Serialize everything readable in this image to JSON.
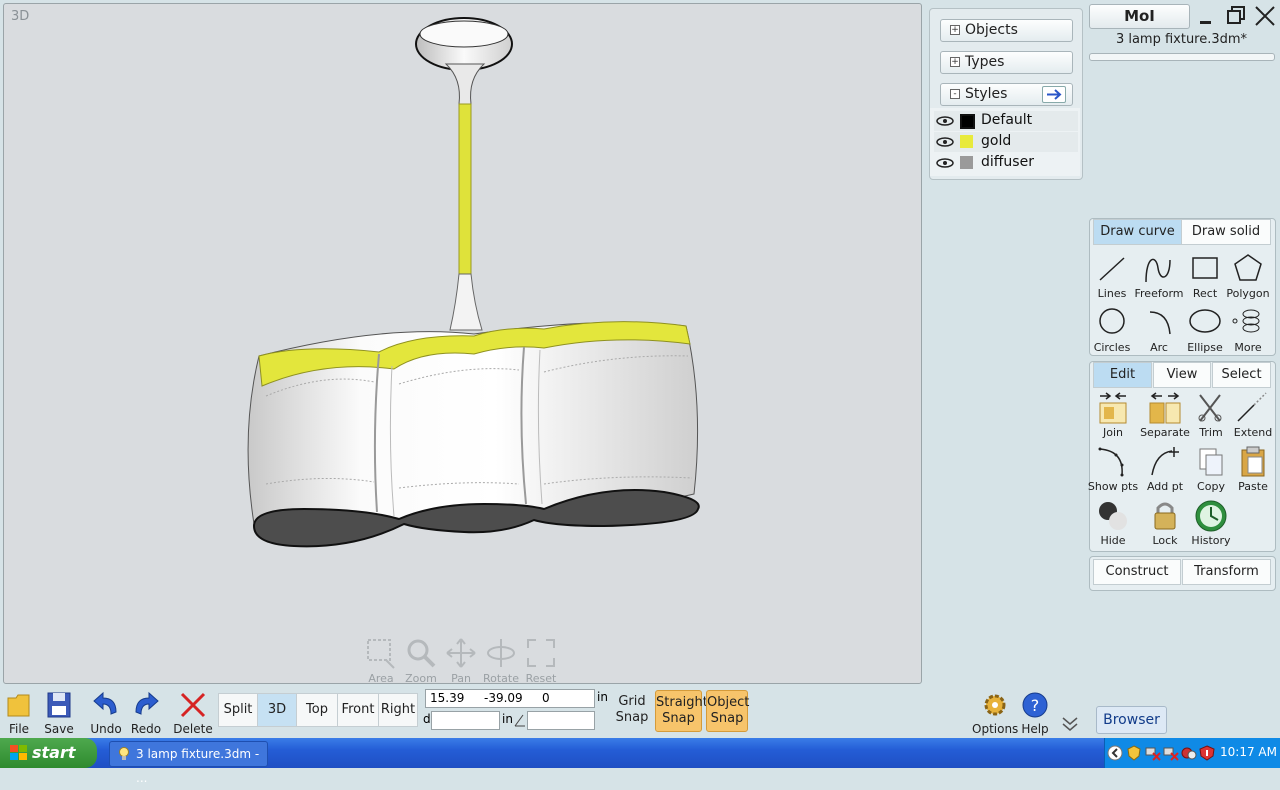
{
  "viewport": {
    "label": "3D"
  },
  "nav_tools": [
    "Area",
    "Zoom",
    "Pan",
    "Rotate",
    "Reset"
  ],
  "palette": {
    "objects_label": "Objects",
    "types_label": "Types",
    "styles_label": "Styles",
    "styles": [
      {
        "name": "Default",
        "color": "#000000"
      },
      {
        "name": "gold",
        "color": "#e8ea3c"
      },
      {
        "name": "diffuser",
        "color": "#9a9a9a"
      }
    ]
  },
  "app": {
    "name": "MoI",
    "file": "3 lamp fixture.3dm*"
  },
  "draw_panel": {
    "tabs": [
      "Draw curve",
      "Draw solid"
    ],
    "tools": [
      "Lines",
      "Freeform",
      "Rect",
      "Polygon",
      "Circles",
      "Arc",
      "Ellipse",
      "More"
    ]
  },
  "edit_panel": {
    "tabs": [
      "Edit",
      "View",
      "Select"
    ],
    "tools": [
      "Join",
      "Separate",
      "Trim",
      "Extend",
      "Show pts",
      "Add pt",
      "Copy",
      "Paste",
      "Hide",
      "Lock",
      "History"
    ]
  },
  "construct_panel": {
    "tabs": [
      "Construct",
      "Transform"
    ]
  },
  "bottom_toolbar": {
    "file_tools": [
      "File",
      "Save",
      "Undo",
      "Redo",
      "Delete"
    ],
    "views": [
      "Split",
      "3D",
      "Top",
      "Front",
      "Right"
    ],
    "coords": {
      "x": "15.39",
      "y": "-39.09",
      "z": "0",
      "unit": "in",
      "d_label": "d",
      "d_unit": "in"
    },
    "grid_snap": "Grid Snap",
    "straight_snap": "Straight Snap",
    "object_snap": "Object Snap",
    "options": "Options",
    "help": "Help",
    "browser": "Browser"
  },
  "taskbar": {
    "start": "start",
    "task": "3 lamp fixture.3dm - ...",
    "clock": "10:17 AM"
  },
  "colors": {
    "accent_gold": "#e8ea3c",
    "selected_tab": "#bcdcf2",
    "snap_on": "#f7c46b",
    "taskbar": "#245dd6"
  }
}
